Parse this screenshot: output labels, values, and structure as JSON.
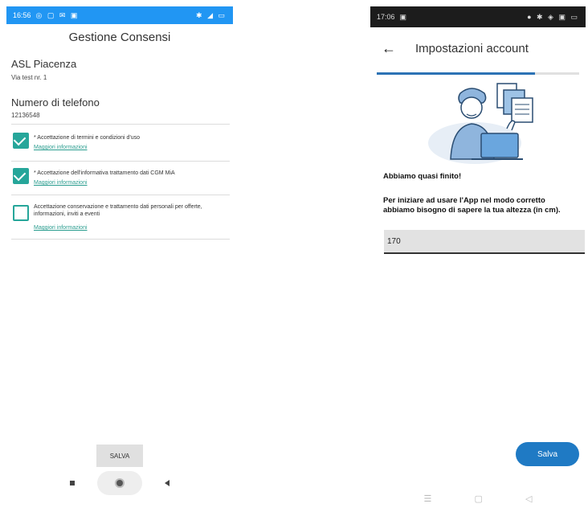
{
  "left": {
    "status": {
      "time": "16:56",
      "icons_left": "◎ ▢ ✉ ▣",
      "icons_right": "✱ ◢ ▭"
    },
    "title": "Gestione Consensi",
    "org_name": "ASL Piacenza",
    "org_address": "Via test nr. 1",
    "phone_label": "Numero di telefono",
    "phone_value": "12136548",
    "consents": [
      {
        "text": "* Accettazione di termini e condizioni d'uso",
        "link": "Maggiori informazioni",
        "checked": true
      },
      {
        "text": "* Accettazione dell'informativa trattamento dati CGM MiA",
        "link": "Maggiori informazioni",
        "checked": true
      },
      {
        "text": "Accettazione conservazione e trattamento dati personali per offerte, informazioni, inviti a eventi",
        "link": "Maggiori informazioni",
        "checked": false
      }
    ],
    "save_label": "SALVA"
  },
  "right": {
    "status": {
      "time": "17:06",
      "icons_left": "▣",
      "icons_right": "● ✱ ◈ ▣ ▭"
    },
    "title": "Impostazioni account",
    "progress": 0.78,
    "intro_title": "Abbiamo quasi finito!",
    "intro_body": "Per iniziare ad usare l'App nel modo corretto abbiamo bisogno di sapere la tua altezza (in cm).",
    "height_value": "170",
    "save_label": "Salva",
    "nav": {
      "menu": "☰",
      "home": "▢",
      "back": "◁"
    }
  },
  "colors": {
    "left_status": "#2196f3",
    "checkbox": "#26a69a",
    "link": "#2a9d8f",
    "primary_button": "#1f7ac4",
    "progress": "#2c72b5"
  },
  "icons": [
    "back-arrow-icon",
    "checkmark-icon",
    "person-laptop-illustration"
  ]
}
